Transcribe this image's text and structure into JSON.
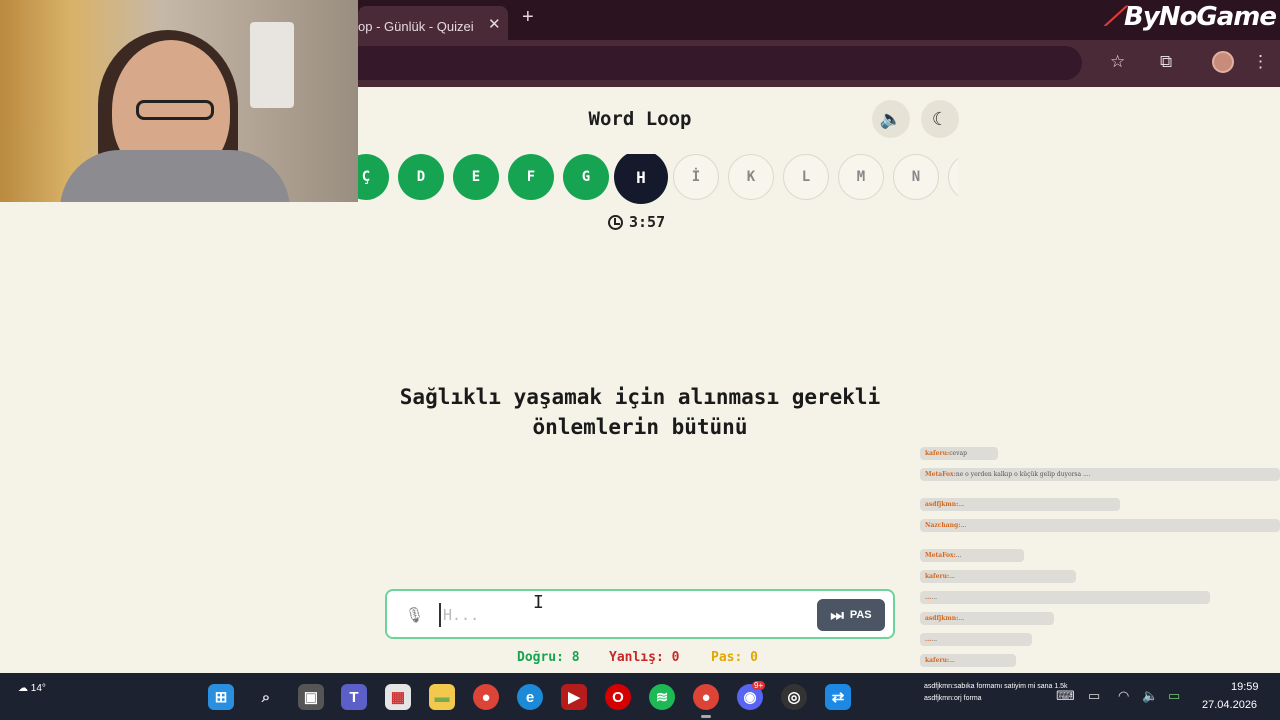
{
  "browser": {
    "tab_title": "op - Günlük - Quizei",
    "tab_close": "✕",
    "new_tab": "+",
    "brand": "ByNoGame",
    "icons": [
      "star-icon",
      "extensions-icon",
      "profile-avatar",
      "menu-icon"
    ]
  },
  "game": {
    "title": "Word Loop",
    "sound_icon": "speaker-icon",
    "theme_icon": "moon-icon",
    "letters": [
      {
        "char": "Ç",
        "state": "done"
      },
      {
        "char": "D",
        "state": "done"
      },
      {
        "char": "E",
        "state": "done"
      },
      {
        "char": "F",
        "state": "done"
      },
      {
        "char": "G",
        "state": "done"
      },
      {
        "char": "H",
        "state": "active"
      },
      {
        "char": "İ",
        "state": "pending"
      },
      {
        "char": "K",
        "state": "pending"
      },
      {
        "char": "L",
        "state": "pending"
      },
      {
        "char": "M",
        "state": "pending"
      },
      {
        "char": "N",
        "state": "pending"
      },
      {
        "char": "",
        "state": "pending"
      }
    ],
    "timer": "3:57",
    "question_line1": "Sağlıklı yaşamak için alınması gerekli",
    "question_line2": "önlemlerin bütünü",
    "answer_placeholder": "H...",
    "answer_value": "",
    "pass_label": "PAS",
    "score": {
      "correct_label": "Doğru: 8",
      "wrong_label": "Yanlış: 0",
      "pass_label": "Pas: 0"
    },
    "colors": {
      "done": "#17a452",
      "active": "#14192b",
      "correct": "#17a452",
      "wrong": "#c62828",
      "pass": "#e0a800"
    }
  },
  "chat": [
    {
      "user": "kaferu:",
      "text": "cevap"
    },
    {
      "user": "MetaFox:",
      "text": "ne o yerden kalkıp o küçük gelip duyorsa ...."
    },
    {
      "user": "asdfjkmn:",
      "text": "..."
    },
    {
      "user": "Nazchang:",
      "text": "..."
    },
    {
      "user": "MetaFox:",
      "text": "..."
    },
    {
      "user": "kaferu:",
      "text": "..."
    },
    {
      "user": "...",
      "text": "..."
    },
    {
      "user": "asdfjkmn:",
      "text": "..."
    },
    {
      "user": "...",
      "text": "..."
    },
    {
      "user": "kaferu:",
      "text": "..."
    }
  ],
  "taskbar": {
    "weather": "14°",
    "chat_line1": "asdfjkmn:sabıka formamı satiyim mi sana 1.5k",
    "chat_line2": "asdfjkmn:orj forma",
    "time": "19:59",
    "date": "27.04.2026",
    "badge": "9+"
  }
}
